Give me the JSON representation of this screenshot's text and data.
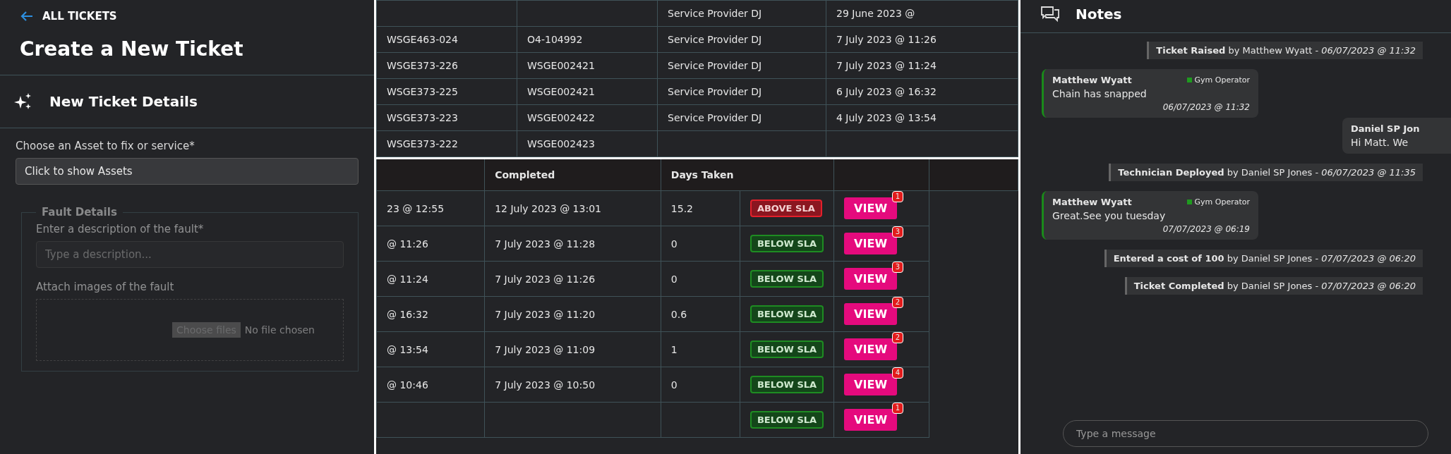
{
  "ticket_form": {
    "back_link": "ALL TICKETS",
    "title": "Create a New Ticket",
    "section_title": "New Ticket Details",
    "asset_label": "Choose an Asset to fix or service*",
    "asset_select": {
      "value": "Click to show Assets"
    },
    "fault_details": {
      "legend": "Fault Details",
      "disabled": true,
      "description_label": "Enter a description of the fault*",
      "description_field": {
        "placeholder": "Type a description..."
      },
      "attach_label": "Attach images of the fault",
      "file_button": "Choose files",
      "file_status": "No file chosen"
    }
  },
  "assets_table": {
    "rows": [
      {
        "cells": [
          null,
          null,
          "Service Provider DJ",
          "29 June 2023 @"
        ]
      },
      {
        "cells": [
          "WSGE463-024",
          "O4-104992",
          "Service Provider DJ",
          "7 July 2023 @ 11:26"
        ]
      },
      {
        "cells": [
          "WSGE373-226",
          "WSGE002421",
          "Service Provider DJ",
          "7 July 2023 @ 11:24"
        ]
      },
      {
        "cells": [
          "WSGE373-225",
          "WSGE002421",
          "Service Provider DJ",
          "6 July 2023 @ 16:32"
        ]
      },
      {
        "cells": [
          "WSGE373-223",
          "WSGE002422",
          "Service Provider DJ",
          "4 July 2023 @ 13:54"
        ]
      },
      {
        "cells": [
          "WSGE373-222",
          "WSGE002423",
          null,
          null
        ]
      }
    ]
  },
  "tickets_table": {
    "columns": [
      null,
      "Completed",
      "Days Taken",
      null
    ],
    "rows": [
      {
        "column_1": "23 @ 12:55",
        "completed": "12 July 2023 @ 13:01",
        "days_taken": "15.2",
        "sla": {
          "label": "ABOVE SLA",
          "kind": "above"
        },
        "action": "VIEW",
        "note_count": "1"
      },
      {
        "column_1": "@ 11:26",
        "completed": "7 July 2023 @ 11:28",
        "days_taken": "0",
        "sla": {
          "label": "BELOW SLA",
          "kind": "below"
        },
        "action": "VIEW",
        "note_count": "3"
      },
      {
        "column_1": "@ 11:24",
        "completed": "7 July 2023 @ 11:26",
        "days_taken": "0",
        "sla": {
          "label": "BELOW SLA",
          "kind": "below"
        },
        "action": "VIEW",
        "note_count": "3"
      },
      {
        "column_1": "@ 16:32",
        "completed": "7 July 2023 @ 11:20",
        "days_taken": "0.6",
        "sla": {
          "label": "BELOW SLA",
          "kind": "below"
        },
        "action": "VIEW",
        "note_count": "2"
      },
      {
        "column_1": "@ 13:54",
        "completed": "7 July 2023 @ 11:09",
        "days_taken": "1",
        "sla": {
          "label": "BELOW SLA",
          "kind": "below"
        },
        "action": "VIEW",
        "note_count": "2"
      },
      {
        "column_1": "@ 10:46",
        "completed": "7 July 2023 @ 10:50",
        "days_taken": "0",
        "sla": {
          "label": "BELOW SLA",
          "kind": "below"
        },
        "action": "VIEW",
        "note_count": "4"
      },
      {
        "column_1": null,
        "completed": null,
        "days_taken": null,
        "sla": {
          "label": "BELOW SLA",
          "kind": "below"
        },
        "action": "VIEW",
        "note_count": "1"
      }
    ]
  },
  "notes": {
    "title": "Notes",
    "items": [
      {
        "kind": "event",
        "text": "**Ticket Raised** by Matthew Wyatt - *06/07/2023 @ 11:32*"
      },
      {
        "kind": "incoming",
        "author": "Matthew Wyatt",
        "role": "Gym Operator",
        "color": "#1f9a1f",
        "text": "Chain has snapped",
        "time": "06/07/2023 @ 11:32"
      },
      {
        "kind": "outgoing",
        "author": "Daniel SP Jon",
        "text": "Hi Matt. We"
      },
      {
        "kind": "event",
        "text": "**Technician Deployed** by Daniel SP Jones - *06/07/2023 @ 11:35*"
      },
      {
        "kind": "incoming",
        "author": "Matthew Wyatt",
        "role": "Gym Operator",
        "color": "#1f9a1f",
        "text": "Great.See you tuesday",
        "time": "07/07/2023 @ 06:19"
      },
      {
        "kind": "event",
        "text": "**Entered a cost of 100** by Daniel SP Jones - *07/07/2023 @ 06:20*"
      },
      {
        "kind": "event",
        "text": "**Ticket Completed** by Daniel SP Jones - *07/07/2023 @ 06:20*"
      }
    ],
    "message_field": {
      "placeholder": "Type a message"
    }
  }
}
